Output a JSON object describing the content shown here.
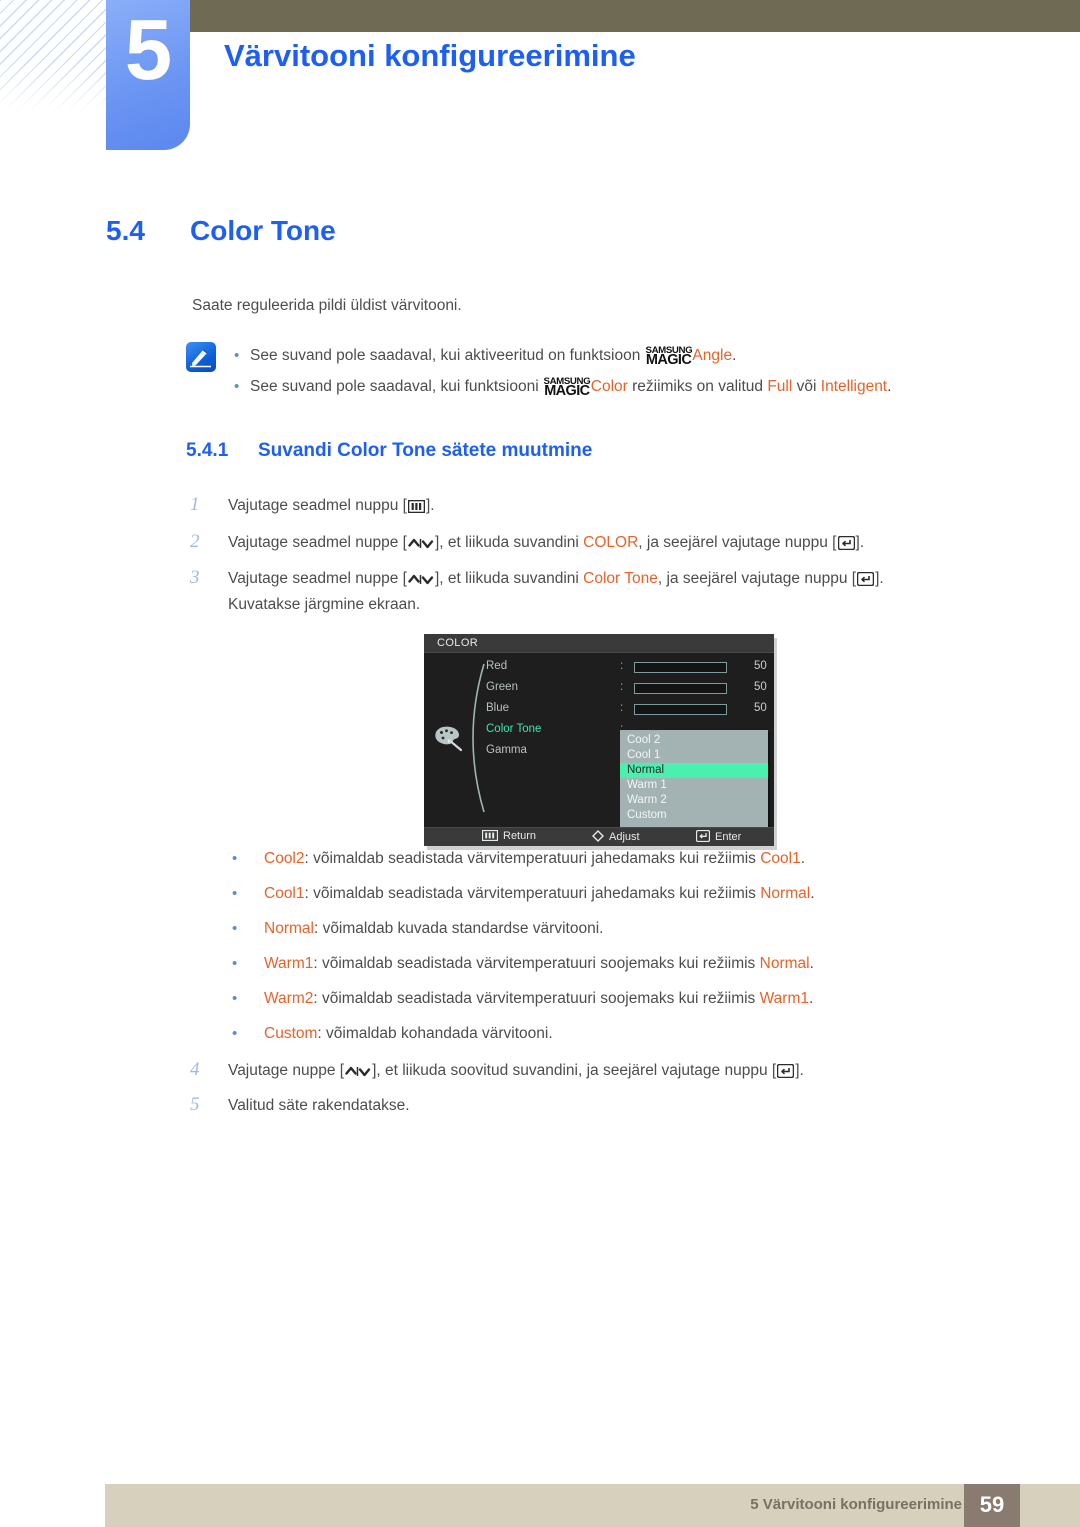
{
  "chapter": {
    "number": "5",
    "title": "Värvitooni konfigureerimine"
  },
  "section": {
    "number": "5.4",
    "title": "Color Tone"
  },
  "intro": "Saate reguleerida pildi üldist värvitooni.",
  "note": {
    "icon_name": "note-pen-icon",
    "bullet_glyph": "•",
    "lines": [
      {
        "pre": "See suvand pole saadaval, kui aktiveeritud on funktsioon ",
        "mark_top": "SAMSUNG",
        "mark_bottom": "MAGIC",
        "highlight": "Angle",
        "post": "."
      },
      {
        "pre": "See suvand pole saadaval, kui funktsiooni ",
        "mark_top": "SAMSUNG",
        "mark_bottom": "MAGIC",
        "highlight": "Color",
        "mid": " režiimiks on valitud ",
        "hl2": "Full",
        "mid2": " või ",
        "hl3": "Intelligent",
        "post": "."
      }
    ]
  },
  "subsection": {
    "number": "5.4.1",
    "title": "Suvandi Color Tone sätete muutmine"
  },
  "steps": [
    {
      "num": "1",
      "pre": "Vajutage seadmel nuppu [",
      "icon": "menu-bars-icon",
      "post": "]."
    },
    {
      "num": "2",
      "pre": "Vajutage seadmel nuppe [",
      "icon": "up-down-arrows-icon",
      "mid": "], et liikuda suvandini ",
      "highlight": "COLOR",
      "mid2": ", ja seejärel vajutage nuppu [",
      "icon2": "enter-key-icon",
      "post": "]."
    },
    {
      "num": "3",
      "pre": "Vajutage seadmel nuppe [",
      "icon": "up-down-arrows-icon",
      "mid": "], et liikuda suvandini ",
      "highlight": "Color Tone",
      "mid2": ", ja seejärel vajutage nuppu [",
      "icon2": "enter-key-icon",
      "post": "].",
      "line2": "Kuvatakse järgmine ekraan."
    },
    {
      "num": "4",
      "pre": "Vajutage nuppe [",
      "icon": "up-down-arrows-icon",
      "mid": "], et liikuda soovitud suvandini, ja seejärel vajutage nuppu [",
      "icon2": "enter-key-icon",
      "post": "]."
    },
    {
      "num": "5",
      "pre": "Valitud säte rakendatakse."
    }
  ],
  "osd": {
    "title": "COLOR",
    "colon": ":",
    "rows": [
      {
        "label": "Red",
        "value": "50",
        "fill_percent": 50,
        "active": false,
        "type": "slider"
      },
      {
        "label": "Green",
        "value": "50",
        "fill_percent": 50,
        "active": false,
        "type": "slider"
      },
      {
        "label": "Blue",
        "value": "50",
        "fill_percent": 50,
        "active": false,
        "type": "slider"
      },
      {
        "label": "Color Tone",
        "value": "",
        "active": true,
        "type": "list"
      },
      {
        "label": "Gamma",
        "value": "",
        "active": false,
        "type": "list"
      }
    ],
    "dropdown": {
      "items": [
        "Cool 2",
        "Cool 1",
        "Normal",
        "Warm 1",
        "Warm 2",
        "Custom"
      ],
      "selected": "Normal"
    },
    "footer": [
      {
        "icon": "menu-bars-icon",
        "label": "Return"
      },
      {
        "icon": "diamond-icon",
        "label": "Adjust"
      },
      {
        "icon": "enter-key-icon",
        "label": "Enter"
      }
    ],
    "colors": {
      "background": "#1e1e1e",
      "titlebar": "#3a3a3a",
      "highlight": "#49f0ae",
      "active_label": "#3ae8a8",
      "dropdown_bg": "#a3b2b2",
      "slider_fill": "#a8bdbd"
    }
  },
  "options": [
    {
      "name": "Cool2",
      "text": ": võimaldab seadistada värvitemperatuuri jahedamaks kui režiimis ",
      "ref": "Cool1",
      "end": "."
    },
    {
      "name": "Cool1",
      "text": ": võimaldab seadistada värvitemperatuuri jahedamaks kui režiimis ",
      "ref": "Normal",
      "end": "."
    },
    {
      "name": "Normal",
      "text": ": võimaldab kuvada standardse värvitooni.",
      "ref": "",
      "end": ""
    },
    {
      "name": "Warm1",
      "text": ": võimaldab seadistada värvitemperatuuri soojemaks kui režiimis ",
      "ref": "Normal",
      "end": "."
    },
    {
      "name": "Warm2",
      "text": ": võimaldab seadistada värvitemperatuuri soojemaks kui režiimis ",
      "ref": "Warm1",
      "end": "."
    },
    {
      "name": "Custom",
      "text": ": võimaldab kohandada värvitooni.",
      "ref": "",
      "end": ""
    }
  ],
  "footer": {
    "text": "5 Värvitooni konfigureerimine",
    "page_number": "59"
  },
  "colors": {
    "accent_blue": "#1d5ff5",
    "highlight_orange": "#e8622a",
    "olive_bar": "#6e6a53",
    "footer_bar": "#d6d0bd",
    "page_badge": "#8a7b70",
    "body_text": "#4d4d4d",
    "step_number": "#9fb8e8",
    "bullet_blue": "#5b8dd9"
  }
}
